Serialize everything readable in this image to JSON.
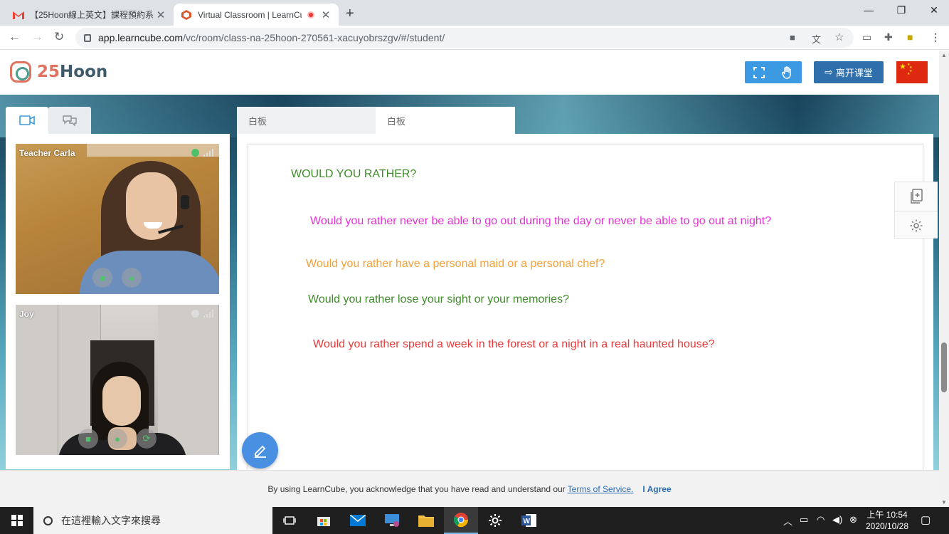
{
  "browser": {
    "tabs": [
      {
        "title": "【25Hoon線上英文】課程預約系",
        "favicon": "gmail-icon"
      },
      {
        "title": "Virtual Classroom | LearnCube",
        "favicon": "learncube-icon",
        "recording": true
      }
    ],
    "url_host": "app.learncube.com",
    "url_path": "/vc/room/class-na-25hoon-270561-xacuyobrszgv/#/student/"
  },
  "app": {
    "logo_number": "25",
    "logo_word": "Hoon",
    "leave_label": "离开课堂",
    "language_flag": "china-flag"
  },
  "video_panel": {
    "tabs": [
      "video-camera-icon",
      "chat-bubbles-icon"
    ],
    "participants": [
      {
        "name": "Teacher Carla",
        "status_color": "#4fc16b"
      },
      {
        "name": "Joy",
        "status_color": "#dddddd"
      }
    ]
  },
  "whiteboard": {
    "tabs": [
      "白板",
      "白板"
    ],
    "active_tab": 1,
    "lines": {
      "title": "WOULD YOU RATHER?",
      "q1": "Would you rather never be able to go out during the day or never be able to go out at night?",
      "q2": "Would you rather have a personal maid or a personal chef?",
      "q3": "Would you rather lose your sight or your memories?",
      "q4": "Would you rather spend a week in the forest or a night in a real haunted house?"
    },
    "colors": {
      "title": "#3f8a2a",
      "q1": "#e631d7",
      "q2": "#f5a13b",
      "q3": "#3f8a2a",
      "q4": "#e83a3a"
    }
  },
  "consent": {
    "text": "By using LearnCube, you acknowledge that you have read and understand our",
    "link": "Terms of Service.",
    "agree": "I Agree"
  },
  "taskbar": {
    "search_placeholder": "在這裡輸入文字來搜尋",
    "time": "上午 10:54",
    "date": "2020/10/28"
  }
}
